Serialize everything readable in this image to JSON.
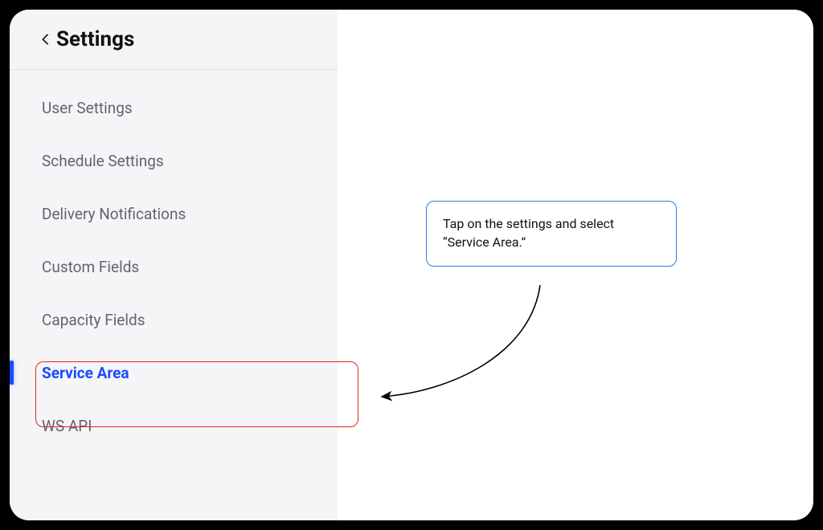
{
  "sidebar": {
    "title": "Settings",
    "items": [
      {
        "label": "User Settings",
        "active": false
      },
      {
        "label": "Schedule Settings",
        "active": false
      },
      {
        "label": "Delivery Notifications",
        "active": false
      },
      {
        "label": "Custom Fields",
        "active": false
      },
      {
        "label": "Capacity Fields",
        "active": false
      },
      {
        "label": "Service Area",
        "active": true
      },
      {
        "label": "WS API",
        "active": false
      }
    ]
  },
  "callout": {
    "text": "Tap on the settings and select “Service Area.”"
  }
}
